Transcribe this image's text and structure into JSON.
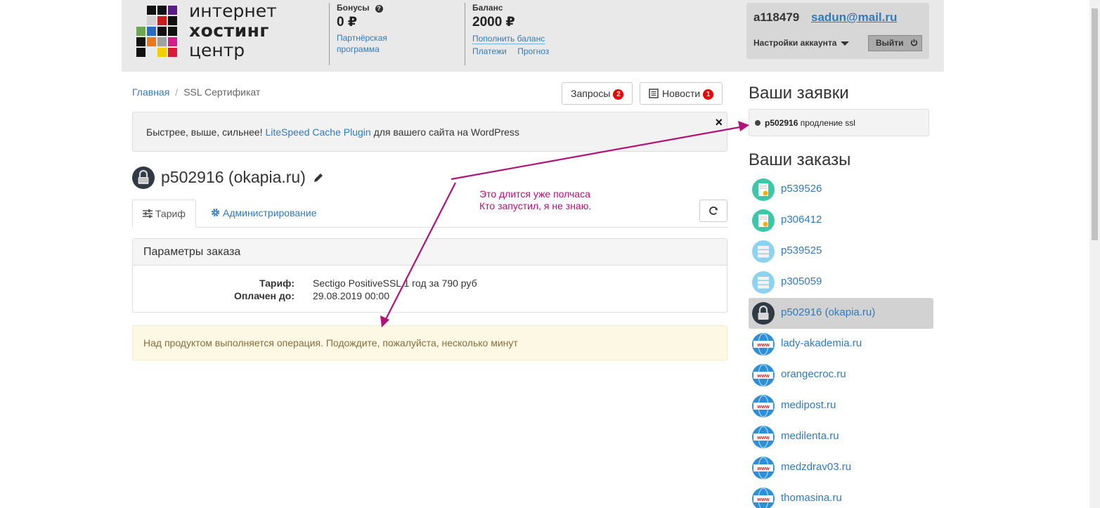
{
  "header": {
    "logo": {
      "line1": "интернет",
      "line2": "хостинг",
      "line3": "центр"
    },
    "bonus": {
      "title": "Бонусы",
      "help_icon": "question-icon",
      "value": "0 ₽",
      "link1": "Партнёрская",
      "link2": "программа"
    },
    "balance": {
      "title": "Баланс",
      "value": "2000 ₽",
      "topup": "Пополнить баланс",
      "payments": "Платежи",
      "forecast": "Прогноз"
    },
    "account": {
      "login": "a118479",
      "email": "sadun@mail.ru",
      "settings": "Настройки аккаунта",
      "logout": "Выйти"
    }
  },
  "breadcrumb": {
    "home": "Главная",
    "sep": "/",
    "current": "SSL Сертификат"
  },
  "buttons": {
    "requests": "Запросы",
    "requests_count": "2",
    "news": "Новости",
    "news_count": "1"
  },
  "promo": {
    "before": "Быстрее, выше, сильнее! ",
    "link": "LiteSpeed Cache Plugin",
    "after": " для вашего сайта на WordPress",
    "close": "×"
  },
  "page_title": "p502916 (okapia.ru)",
  "tabs": {
    "tariff": "Тариф",
    "admin": "Администрирование"
  },
  "params": {
    "title": "Параметры заказа",
    "tariff_label": "Тариф:",
    "tariff_value": "Sectigo PositiveSSL 1 год за 790 руб",
    "paid_label": "Оплачен до:",
    "paid_value": "29.08.2019 00:00"
  },
  "warning": "Над продуктом выполняется операция. Подождите, пожалуйста, несколько минут",
  "sidebar": {
    "requests_title": "Ваши заявки",
    "request": {
      "id": "p502916",
      "text": " продление ssl"
    },
    "orders_title": "Ваши заказы",
    "orders": [
      {
        "label": "p539526",
        "icon": "certificate-icon"
      },
      {
        "label": "p306412",
        "icon": "certificate-icon"
      },
      {
        "label": "p539525",
        "icon": "server-icon"
      },
      {
        "label": "p305059",
        "icon": "server-icon"
      },
      {
        "label": "p502916 (okapia.ru)",
        "icon": "lock-icon"
      },
      {
        "label": "lady-akademia.ru",
        "icon": "www-globe-icon"
      },
      {
        "label": "orangecroc.ru",
        "icon": "www-globe-icon"
      },
      {
        "label": "medipost.ru",
        "icon": "www-globe-icon"
      },
      {
        "label": "medilenta.ru",
        "icon": "www-globe-icon"
      },
      {
        "label": "medzdrav03.ru",
        "icon": "www-globe-icon"
      },
      {
        "label": "thomasina.ru",
        "icon": "www-globe-icon"
      }
    ]
  },
  "annotation": {
    "line1": "Это длится уже полчаса",
    "line2": "Кто запустил, я не знаю.",
    "color": "#b0127a"
  }
}
